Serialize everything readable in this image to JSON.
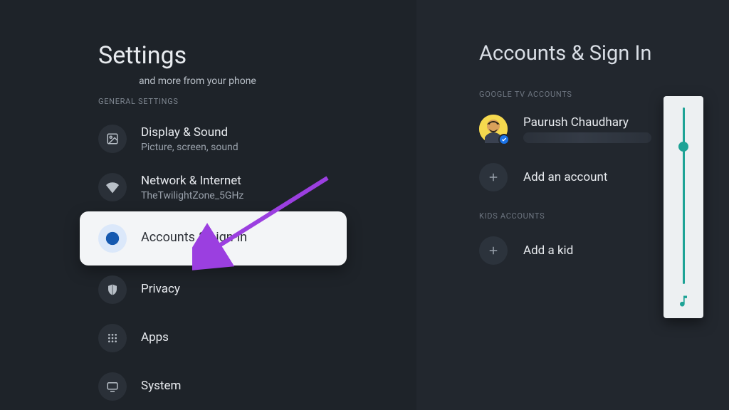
{
  "left": {
    "title": "Settings",
    "hint": "and more from your phone",
    "section_general": "GENERAL SETTINGS",
    "items": [
      {
        "title": "Display & Sound",
        "sub": "Picture, screen, sound"
      },
      {
        "title": "Network & Internet",
        "sub": "TheTwilightZone_5GHz"
      },
      {
        "title": "Accounts & sign-in"
      },
      {
        "title": "Privacy"
      },
      {
        "title": "Apps"
      },
      {
        "title": "System"
      }
    ]
  },
  "right": {
    "title": "Accounts & Sign In",
    "section_google": "GOOGLE TV ACCOUNTS",
    "account": {
      "name": "Paurush Chaudhary"
    },
    "add_account": "Add an account",
    "section_kids": "KIDS ACCOUNTS",
    "add_kid": "Add a kid"
  },
  "volume": {
    "percent": 78
  },
  "colors": {
    "accent": "#1ea396",
    "arrow": "#8a2be2"
  }
}
